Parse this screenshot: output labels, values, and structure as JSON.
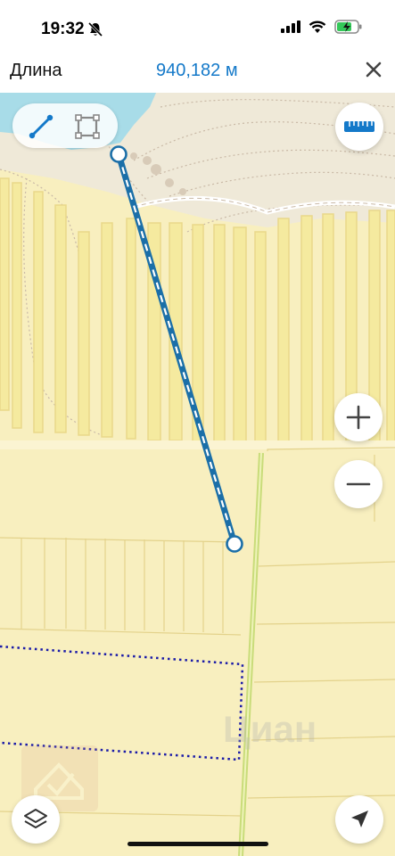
{
  "status_bar": {
    "time": "19:32",
    "icons": [
      "bell-slash-icon",
      "signal-icon",
      "wifi-icon",
      "battery-charging-icon"
    ]
  },
  "header": {
    "title": "Длина",
    "value": "940,182 м",
    "value_color": "#1479c9",
    "close_icon": "close-icon"
  },
  "map": {
    "measure_line_color": "#1b6fa8",
    "parcel_outline_color": "#1a1aa8",
    "water_color": "#a8dce8",
    "land_color": "#f8efbf",
    "watermark_text": "Циан"
  },
  "controls": {
    "line_mode_icon": "line-measure-icon",
    "area_mode_icon": "area-measure-icon",
    "ruler_icon": "ruler-icon",
    "zoom_in_icon": "plus-icon",
    "zoom_out_icon": "minus-icon",
    "layers_icon": "layers-icon",
    "location_icon": "location-arrow-icon",
    "accent_color": "#1479c9"
  }
}
